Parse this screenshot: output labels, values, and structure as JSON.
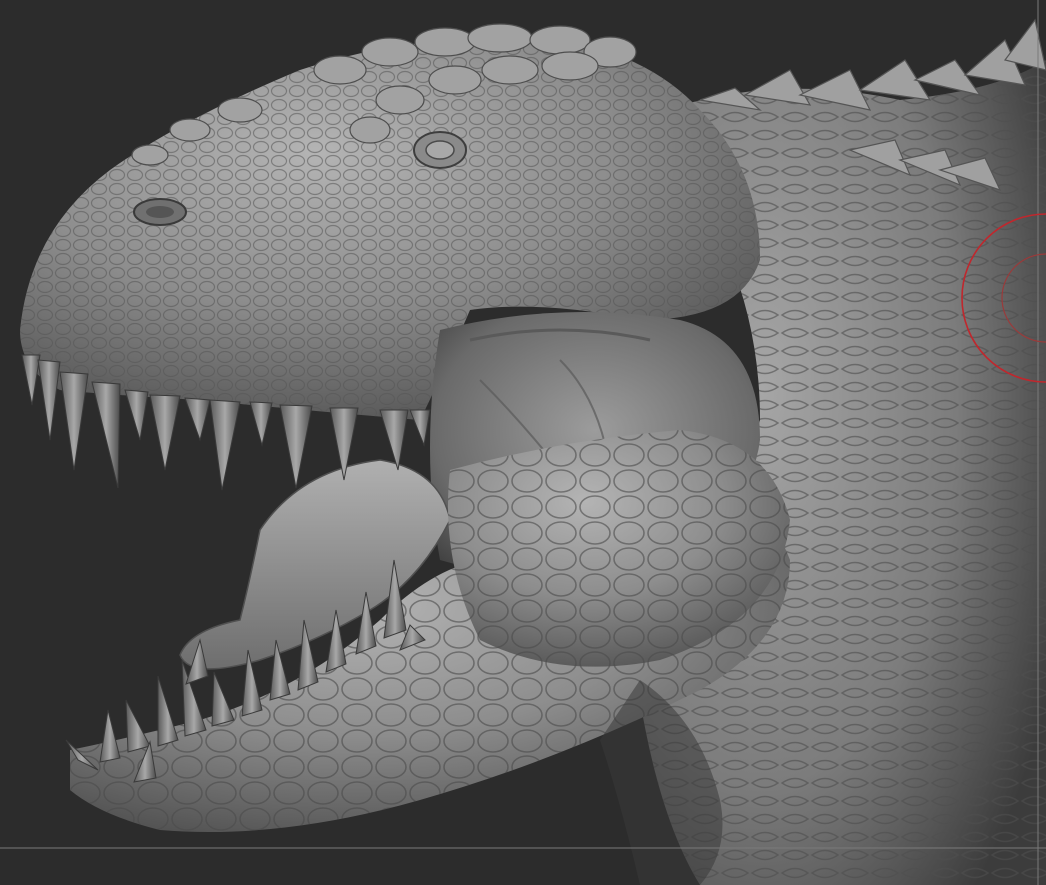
{
  "app": {
    "type": "3d-sculpt-viewport"
  },
  "viewport": {
    "background_color": "#2c2c2c",
    "subject": "sculpted-trex-head",
    "mesh_color": "#8e8e8e",
    "mesh_shadow_color": "#3a3a3a",
    "brush_cursor": {
      "outer_color": "#c0272d",
      "inner_color": "#9a3a3a"
    },
    "frame_guide_color": "#7a7a7a"
  }
}
